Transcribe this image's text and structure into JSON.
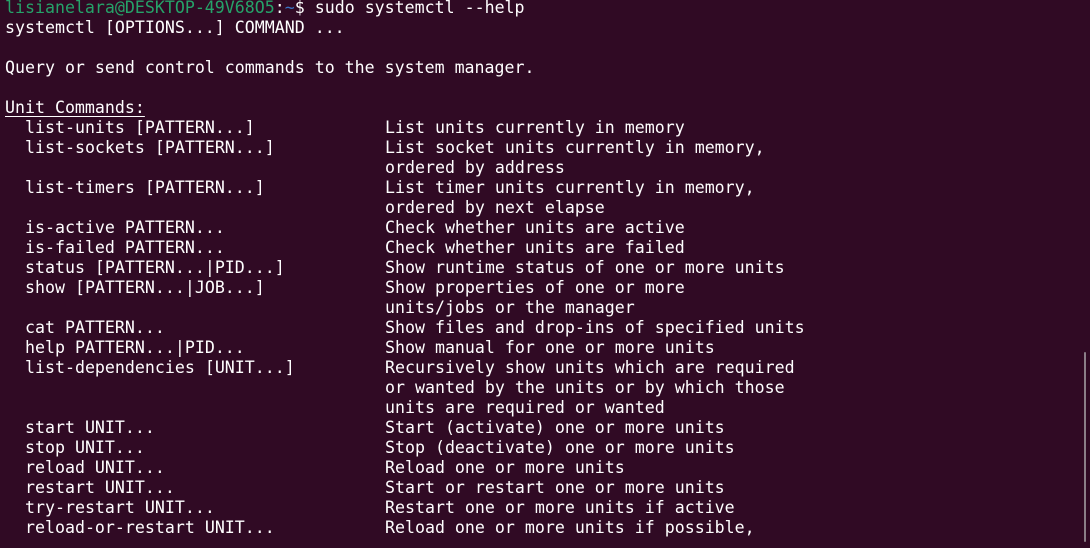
{
  "prompt": {
    "user_host": "lisianelara@DESKTOP-49V68O5",
    "separator": ":",
    "path": "~",
    "symbol": "$",
    "command": " sudo systemctl --help"
  },
  "usage": "systemctl [OPTIONS...] COMMAND ...",
  "description": "Query or send control commands to the system manager.",
  "section_title": "Unit Commands:",
  "rows": [
    {
      "cmd": "list-units [PATTERN...]",
      "desc": "List units currently in memory"
    },
    {
      "cmd": "list-sockets [PATTERN...]",
      "desc": "List socket units currently in memory,"
    },
    {
      "cmd": "",
      "desc": "ordered by address"
    },
    {
      "cmd": "list-timers [PATTERN...]",
      "desc": "List timer units currently in memory,"
    },
    {
      "cmd": "",
      "desc": "ordered by next elapse"
    },
    {
      "cmd": "is-active PATTERN...",
      "desc": "Check whether units are active"
    },
    {
      "cmd": "is-failed PATTERN...",
      "desc": "Check whether units are failed"
    },
    {
      "cmd": "status [PATTERN...|PID...]",
      "desc": "Show runtime status of one or more units"
    },
    {
      "cmd": "show [PATTERN...|JOB...]",
      "desc": "Show properties of one or more"
    },
    {
      "cmd": "",
      "desc": "units/jobs or the manager"
    },
    {
      "cmd": "cat PATTERN...",
      "desc": "Show files and drop-ins of specified units"
    },
    {
      "cmd": "help PATTERN...|PID...",
      "desc": "Show manual for one or more units"
    },
    {
      "cmd": "list-dependencies [UNIT...]",
      "desc": "Recursively show units which are required"
    },
    {
      "cmd": "",
      "desc": "or wanted by the units or by which those"
    },
    {
      "cmd": "",
      "desc": "units are required or wanted"
    },
    {
      "cmd": "start UNIT...",
      "desc": "Start (activate) one or more units"
    },
    {
      "cmd": "stop UNIT...",
      "desc": "Stop (deactivate) one or more units"
    },
    {
      "cmd": "reload UNIT...",
      "desc": "Reload one or more units"
    },
    {
      "cmd": "restart UNIT...",
      "desc": "Start or restart one or more units"
    },
    {
      "cmd": "try-restart UNIT...",
      "desc": "Restart one or more units if active"
    },
    {
      "cmd": "reload-or-restart UNIT...",
      "desc": "Reload one or more units if possible,"
    }
  ],
  "colors": {
    "background": "#300a24",
    "text": "#ffffff",
    "prompt_user": "#26a269",
    "prompt_path": "#3a72c2"
  }
}
